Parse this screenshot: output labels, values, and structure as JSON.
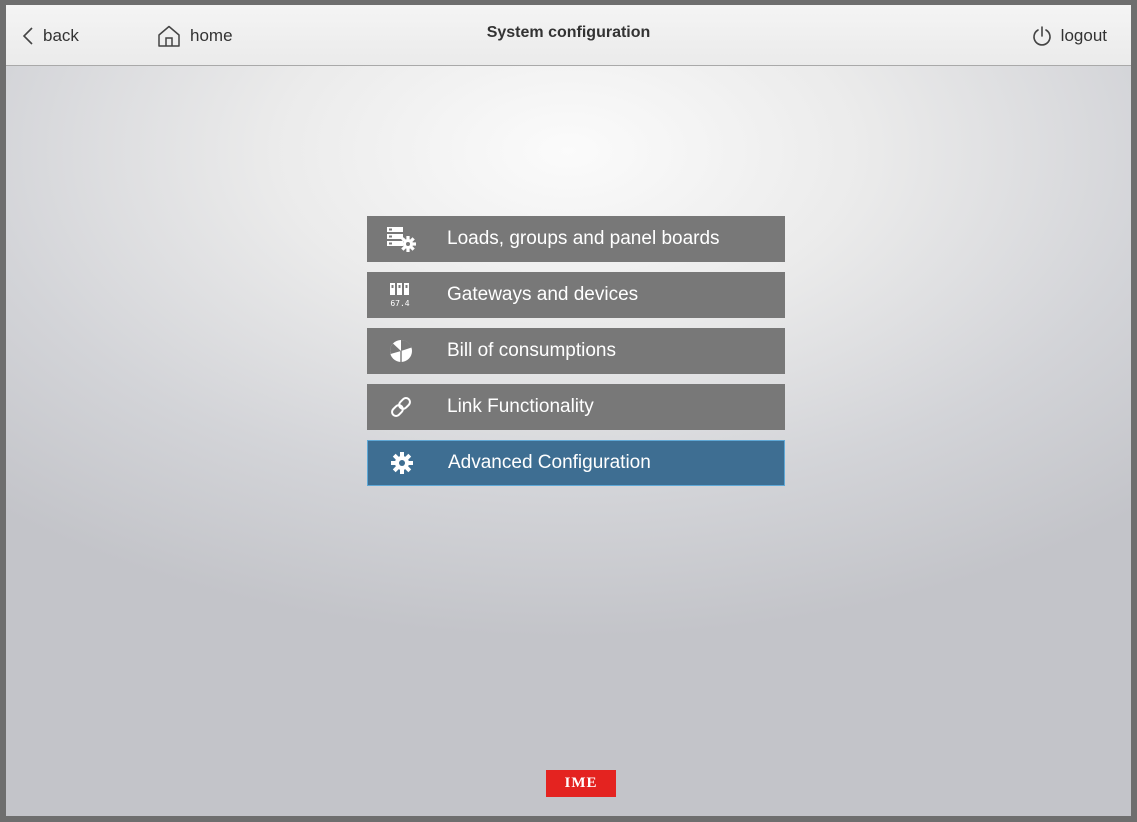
{
  "header": {
    "back_label": "back",
    "home_label": "home",
    "title": "System configuration",
    "logout_label": "logout"
  },
  "menu": {
    "items": [
      {
        "label": "Loads, groups and panel boards",
        "icon": "loads-panel-icon"
      },
      {
        "label": "Gateways and devices",
        "icon": "gateway-devices-icon"
      },
      {
        "label": "Bill of consumptions",
        "icon": "pie-chart-icon"
      },
      {
        "label": "Link Functionality",
        "icon": "link-icon"
      },
      {
        "label": "Advanced Configuration",
        "icon": "gear-icon",
        "active": true
      }
    ],
    "device_icon_text": "67.4"
  },
  "footer": {
    "logo_text": "IME"
  },
  "colors": {
    "menu_item_bg": "#787878",
    "menu_item_active_bg": "#3e6e92",
    "logo_bg": "#e42320"
  }
}
